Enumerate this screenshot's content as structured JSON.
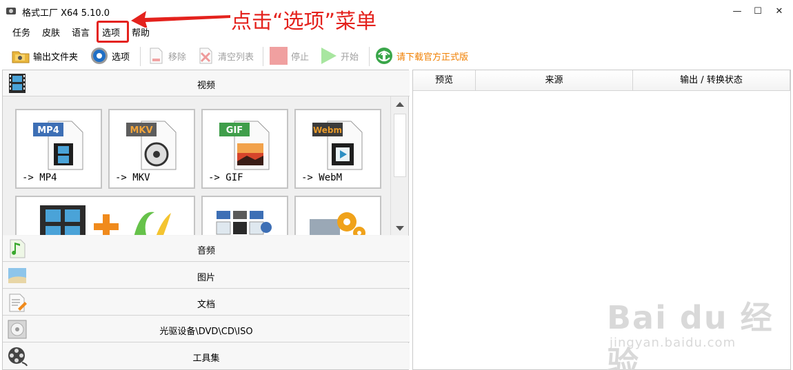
{
  "window": {
    "title": "格式工厂 X64 5.10.0",
    "minimize": "—",
    "maximize": "☐",
    "close": "✕"
  },
  "menu": {
    "items": [
      "任务",
      "皮肤",
      "语言",
      "选项",
      "帮助"
    ]
  },
  "toolbar": {
    "output_folder": "输出文件夹",
    "options": "选项",
    "remove": "移除",
    "clear_list": "清空列表",
    "stop": "停止",
    "start": "开始",
    "download_official": "请下载官方正式版"
  },
  "annotation": {
    "text": "点击“选项”菜单",
    "color": "#e4221d"
  },
  "left": {
    "video_header": "视频",
    "tiles": [
      {
        "label": "-> MP4",
        "badge": "MP4",
        "badge_color": "#3d6fb5"
      },
      {
        "label": "-> MKV",
        "badge": "MKV",
        "badge_color": "#7a5b3a"
      },
      {
        "label": "-> GIF",
        "badge": "GIF",
        "badge_color": "#3f9e4a"
      },
      {
        "label": "-> WebM",
        "badge": "Webm",
        "badge_color": "#c9781e"
      }
    ],
    "categories": [
      "音频",
      "图片",
      "文档",
      "光驱设备\\DVD\\CD\\ISO",
      "工具集"
    ]
  },
  "right": {
    "columns": [
      "预览",
      "来源",
      "输出 / 转换状态"
    ]
  },
  "watermark": {
    "big": "Bai du 经验",
    "small": "jingyan.baidu.com"
  }
}
